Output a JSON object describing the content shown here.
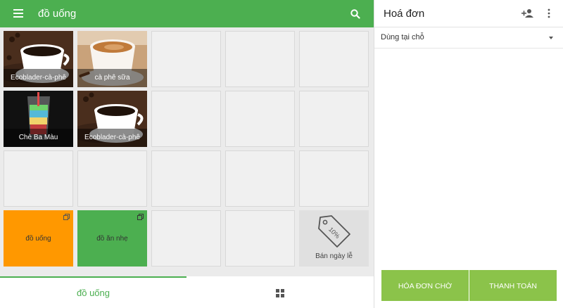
{
  "header": {
    "title": "đồ uống"
  },
  "tiles": {
    "t1": {
      "label": "Ecoblader-cà-phê"
    },
    "t2": {
      "label": "cà phê sữa"
    },
    "t3": {
      "label": "Chè Ba Màu"
    },
    "t4": {
      "label": "Ecoblader-cà-phê"
    },
    "cat1": {
      "label": "đồ uống",
      "color": "#ff9800"
    },
    "cat2": {
      "label": "đồ ăn nhẹ",
      "color": "#4caf50"
    },
    "promo": {
      "label": "Bán ngày lễ",
      "badge": "10%"
    }
  },
  "bottom_nav": {
    "tab1_label": "đồ uống"
  },
  "invoice": {
    "title": "Hoá đơn",
    "dine_option": "Dùng tại chỗ",
    "hold_button": "HÓA ĐƠN CHỜ",
    "pay_button": "THANH TOÁN"
  },
  "icons": [
    "menu-icon",
    "search-icon",
    "add-person-icon",
    "more-vert-icon",
    "dropdown-arrow-icon",
    "stack-icon",
    "price-tag-icon",
    "grid-icon"
  ],
  "colors": {
    "primary": "#4caf50",
    "accent": "#8bc34a",
    "orange": "#ff9800"
  }
}
